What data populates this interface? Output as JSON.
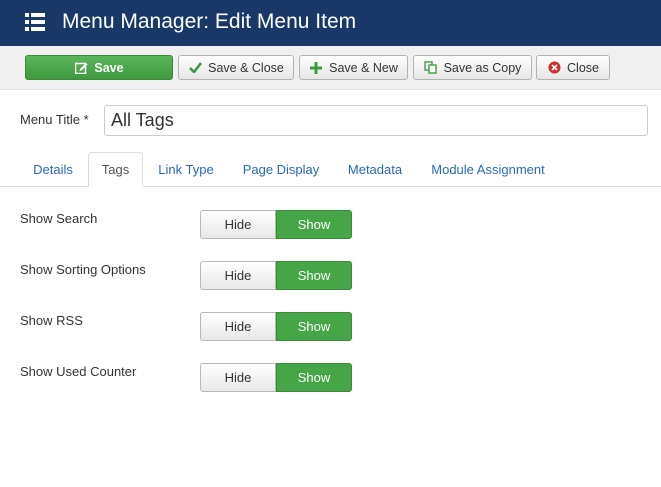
{
  "header": {
    "title": "Menu Manager: Edit Menu Item",
    "icon": "list-icon"
  },
  "toolbar": {
    "save": "Save",
    "save_close": "Save & Close",
    "save_new": "Save & New",
    "save_copy": "Save as Copy",
    "close": "Close"
  },
  "form": {
    "title_label": "Menu Title *",
    "title_value": "All Tags"
  },
  "tabs": [
    "Details",
    "Tags",
    "Link Type",
    "Page Display",
    "Metadata",
    "Module Assignment"
  ],
  "active_tab": "Tags",
  "options": [
    {
      "label": "Show Search",
      "hide": "Hide",
      "show": "Show",
      "selected": "Show"
    },
    {
      "label": "Show Sorting Options",
      "hide": "Hide",
      "show": "Show",
      "selected": "Show"
    },
    {
      "label": "Show RSS",
      "hide": "Hide",
      "show": "Show",
      "selected": "Show"
    },
    {
      "label": "Show Used Counter",
      "hide": "Hide",
      "show": "Show",
      "selected": "Show"
    }
  ],
  "colors": {
    "header": "#1a3867",
    "save_green": "#46a546",
    "link_blue": "#2a69b8",
    "close_red": "#c9302c"
  }
}
